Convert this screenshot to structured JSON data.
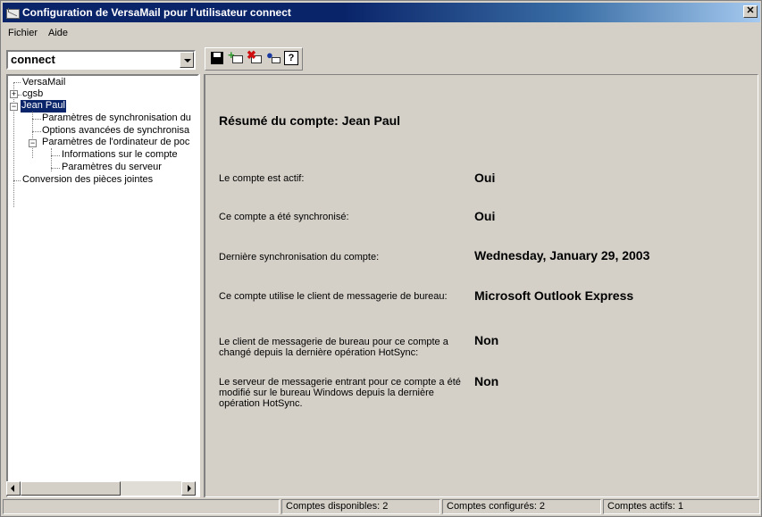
{
  "window": {
    "title": "Configuration de VersaMail pour l'utilisateur connect",
    "close_label": "✕"
  },
  "menu": {
    "items": [
      "Fichier",
      "Aide"
    ]
  },
  "user_combo": {
    "value": "connect"
  },
  "toolbar": {
    "icons": [
      "save-icon",
      "add-account-icon",
      "delete-account-icon",
      "user-account-icon",
      "help-icon"
    ],
    "help_glyph": "?"
  },
  "tree": {
    "root": "VersaMail",
    "nodes": [
      "cgsb",
      "Jean Paul",
      "Paramètres de synchronisation du",
      "Options avancées de synchronisa",
      "Paramètres de l'ordinateur de poc",
      "Informations sur le compte",
      "Paramètres du serveur",
      "Conversion des pièces jointes"
    ],
    "expanded_glyph": "−",
    "collapsed_glyph": "+"
  },
  "summary": {
    "title": "Résumé du compte: Jean Paul",
    "rows": [
      {
        "label": "Le compte est actif:",
        "value": "Oui"
      },
      {
        "label": "Ce compte a été synchronisé:",
        "value": "Oui"
      },
      {
        "label": "Dernière synchronisation du compte:",
        "value": "Wednesday, January 29, 2003"
      },
      {
        "label": "Ce compte utilise le client de messagerie de bureau:",
        "value": "Microsoft Outlook Express"
      },
      {
        "label": "Le client de messagerie de bureau pour ce compte a changé depuis la dernière opération HotSync:",
        "value": "Non"
      },
      {
        "label": "Le serveur de messagerie entrant pour ce compte a été modifié sur le bureau Windows depuis la dernière opération HotSync.",
        "value": "Non"
      }
    ]
  },
  "status": {
    "available": "Comptes disponibles: 2",
    "configured": "Comptes configurés: 2",
    "active": "Comptes actifs: 1"
  },
  "colors": {
    "title_active": "#0a246a",
    "face": "#d4d0c8",
    "selection": "#0a246a"
  }
}
